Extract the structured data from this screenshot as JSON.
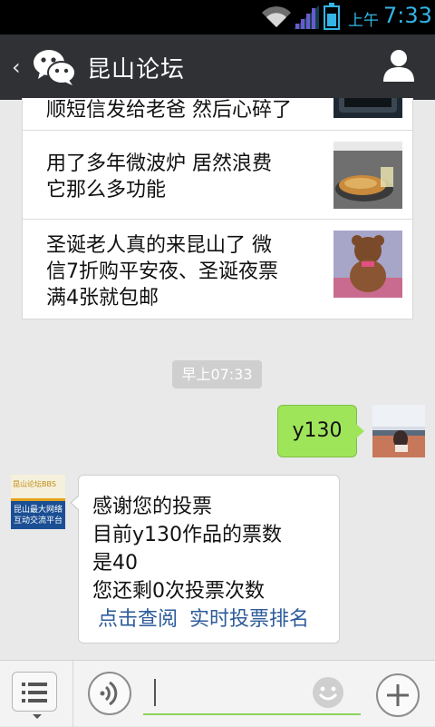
{
  "status_bar": {
    "ampm": "上午",
    "time": "7:33",
    "icons": [
      "wifi-icon",
      "signal-icon",
      "battery-icon"
    ],
    "accent_color": "#33b5e5"
  },
  "header": {
    "title": "昆山论坛",
    "back_icon": "‹",
    "icons": [
      "back-icon",
      "wechat-logo-icon",
      "user-profile-icon"
    ],
    "background": "#2f3134"
  },
  "articles": [
    {
      "title": "顺短信发给老爸 然后心碎了",
      "lines": [
        "顺短信发给老爸 然后心碎了"
      ],
      "thumbnail": "phone-photo"
    },
    {
      "title": "用了多年微波炉 居然浪费它那么多功能",
      "lines": [
        "用了多年微波炉 居然浪费",
        "它那么多功能"
      ],
      "thumbnail": "pizza-microwave-photo"
    },
    {
      "title": "圣诞老人真的来昆山了 微信7折购平安夜、圣诞夜票满4张就包邮",
      "lines": [
        "圣诞老人真的来昆山了 微",
        "信7折购平安夜、圣诞夜票",
        "满4张就包邮"
      ],
      "thumbnail": "teddy-bear-photo"
    }
  ],
  "chat": {
    "timestamp": "早上07:33",
    "my_message": "y130",
    "bot_lines": [
      "感谢您的投票",
      "目前y130作品的票数",
      "是40",
      "您还剩0次投票次数"
    ],
    "bot_links": [
      "点击查阅",
      "实时投票排名"
    ],
    "bot_avatar_text": [
      "昆山论坛BBS",
      "昆山最大网络",
      "互动交流平台"
    ],
    "bubble_color": "#9fe55a",
    "link_color": "#2d5b9a"
  },
  "input_bar": {
    "icons": [
      "menu-list-icon",
      "voice-icon",
      "emoji-icon",
      "plus-icon"
    ],
    "underline_color": "#8bd35a"
  }
}
